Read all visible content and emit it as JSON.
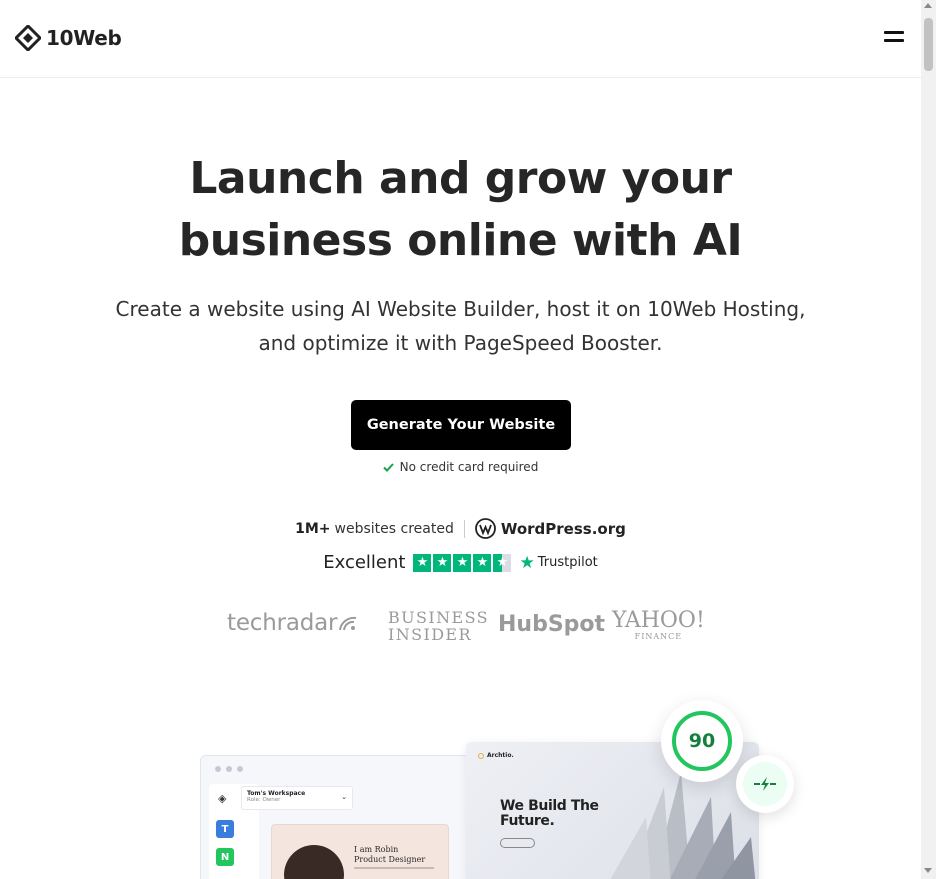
{
  "header": {
    "logo_text": "10Web",
    "menu_icon": "hamburger-menu-icon"
  },
  "hero": {
    "title_line1": "Launch and grow your",
    "title_line2": "business online with AI",
    "subtitle_line1": "Create a website using AI Website Builder, host it on 10Web Hosting,",
    "subtitle_line2": "and optimize it with PageSpeed Booster.",
    "cta_label": "Generate Your Website",
    "no_cc": "No credit card required"
  },
  "stats": {
    "count": "1M+",
    "count_label": "websites created",
    "partner": "WordPress.org"
  },
  "rating": {
    "label": "Excellent",
    "stars": 4.5,
    "provider": "Trustpilot"
  },
  "press": {
    "techradar": "techradar",
    "business_insider_1": "BUSINESS",
    "business_insider_2": "INSIDER",
    "hubspot": "HubSpot",
    "yahoo": "YAHOO!",
    "yahoo_sub": "FINANCE"
  },
  "mockup": {
    "workspace_name": "Tom's Workspace",
    "workspace_role": "Role: Owner",
    "side_t": "T",
    "side_n": "N",
    "robin_line1": "I am Robin",
    "robin_line2": "Product Designer",
    "site_brand": "Archtio.",
    "site_headline_1": "We Build The",
    "site_headline_2": "Future.",
    "score": "90"
  },
  "colors": {
    "cta_bg": "#000000",
    "trustpilot_green": "#00b67a",
    "score_green": "#22c55e"
  }
}
